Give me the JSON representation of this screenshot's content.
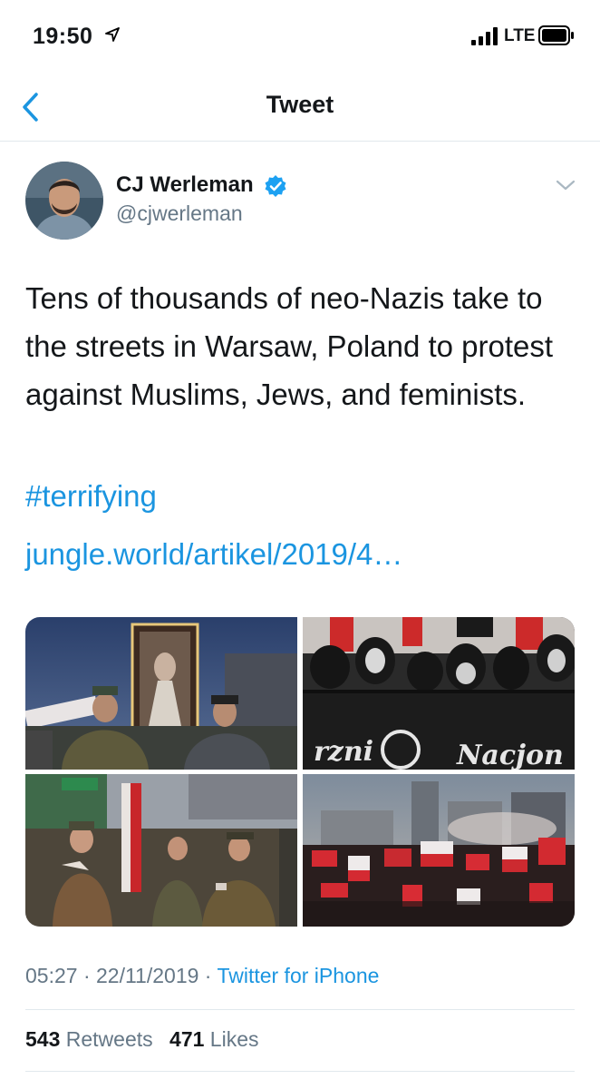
{
  "status_bar": {
    "time": "19:50",
    "network": "LTE",
    "icons": [
      "location-arrow-icon",
      "signal-bars-icon",
      "battery-icon"
    ]
  },
  "nav": {
    "title": "Tweet",
    "back_icon": "chevron-left-icon"
  },
  "tweet": {
    "author": {
      "name": "CJ Werleman",
      "handle": "@cjwerleman",
      "verified": true
    },
    "text": "Tens of thousands of neo-Nazis take to the streets in Warsaw, Poland to protest against Muslims, Jews, and feminists.",
    "hashtag": "#terrifying",
    "link": "jungle.world/artikel/2019/4…",
    "media_count": 4,
    "photo_text": {
      "banner_1": "rzni",
      "banner_2": "Nacjon"
    },
    "timestamp": "05:27 · 22/11/2019 · ",
    "source": "Twitter for iPhone",
    "retweets": {
      "count": "543",
      "label": "Retweets"
    },
    "likes": {
      "count": "471",
      "label": "Likes"
    }
  },
  "colors": {
    "accent": "#1b95e0",
    "text": "#14171a",
    "secondary": "#657786",
    "divider": "#e1e8ed"
  }
}
